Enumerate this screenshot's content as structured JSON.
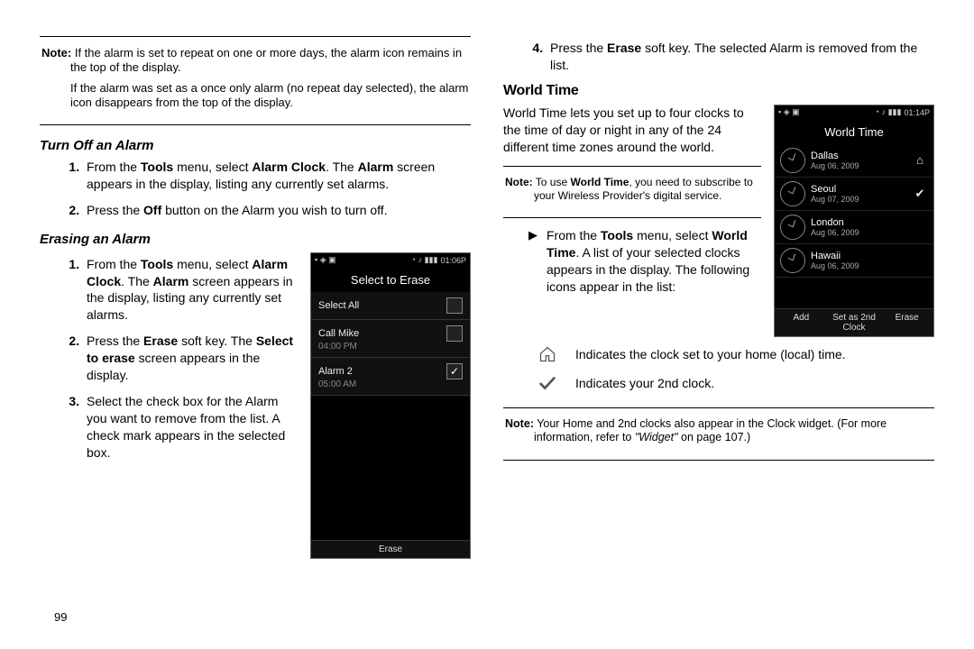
{
  "left": {
    "note1_label": "Note:",
    "note1_p1": "If the alarm is set to repeat on one or more days, the alarm icon remains in the top of the display.",
    "note1_p2": "If the alarm was set as a once only alarm (no repeat day selected), the alarm icon disappears from the top of the display.",
    "h_turnoff": "Turn Off an Alarm",
    "turnoff_step1_a": "From the ",
    "turnoff_step1_b": "Tools",
    "turnoff_step1_c": " menu, select ",
    "turnoff_step1_d": "Alarm Clock",
    "turnoff_step1_e": ". The ",
    "turnoff_step1_f": "Alarm",
    "turnoff_step1_g": " screen appears in the display, listing any currently set alarms.",
    "turnoff_step2_a": "Press the ",
    "turnoff_step2_b": "Off",
    "turnoff_step2_c": " button on the Alarm you wish to turn off.",
    "h_erase": "Erasing an Alarm",
    "erase_step1_a": "From the ",
    "erase_step1_b": "Tools",
    "erase_step1_c": " menu, select ",
    "erase_step1_d": "Alarm Clock",
    "erase_step1_e": ". The ",
    "erase_step1_f": "Alarm",
    "erase_step1_g": " screen appears in the display, listing any currently set alarms.",
    "erase_step2_a": "Press the ",
    "erase_step2_b": "Erase",
    "erase_step2_c": " soft key. The ",
    "erase_step2_d": "Select to erase",
    "erase_step2_e": " screen appears in the display.",
    "erase_step3": "Select the check box for the Alarm you want to remove from the list. A check mark appears in the selected box.",
    "page_number": "99"
  },
  "right": {
    "step4_a": "Press the ",
    "step4_b": "Erase",
    "step4_c": " soft key. The selected Alarm is removed from the list.",
    "h_world": "World Time",
    "world_intro": "World Time lets you set up to four clocks to the time of day or night in any of the 24 different time zones around the world.",
    "note2_label": "Note:",
    "note2_a": "To use ",
    "note2_b": "World Time",
    "note2_c": ", you need to subscribe to your Wireless Provider's digital service.",
    "world_bullet_a": "From the ",
    "world_bullet_b": "Tools",
    "world_bullet_c": " menu, select ",
    "world_bullet_d": "World Time",
    "world_bullet_e": ". A list of your selected clocks appears in the display. The following icons appear in the list:",
    "icon_home_text": "Indicates the clock set to your home (local) time.",
    "icon_2nd_text": "Indicates your 2nd clock.",
    "note3_label": "Note:",
    "note3_a": "Your Home and 2nd clocks also appear in the Clock widget. (For more information, refer to ",
    "note3_b": "\"Widget\"",
    "note3_c": " on page 107.)"
  },
  "phone_erase": {
    "status_time": "01:06P",
    "title": "Select to Erase",
    "rows": [
      {
        "label": "Select All",
        "sub": "",
        "checked": false
      },
      {
        "label": "Call Mike",
        "sub": "04:00 PM",
        "checked": false
      },
      {
        "label": "Alarm 2",
        "sub": "05:00 AM",
        "checked": true
      }
    ],
    "softkey": "Erase"
  },
  "phone_world": {
    "status_time": "01:14P",
    "title": "World Time",
    "rows": [
      {
        "city": "Dallas",
        "date": "Aug 06, 2009",
        "mark": "home"
      },
      {
        "city": "Seoul",
        "date": "Aug 07, 2009",
        "mark": "check"
      },
      {
        "city": "London",
        "date": "Aug 06, 2009",
        "mark": ""
      },
      {
        "city": "Hawaii",
        "date": "Aug 06, 2009",
        "mark": ""
      }
    ],
    "softkeys": [
      "Add",
      "Set as 2nd Clock",
      "Erase"
    ]
  }
}
